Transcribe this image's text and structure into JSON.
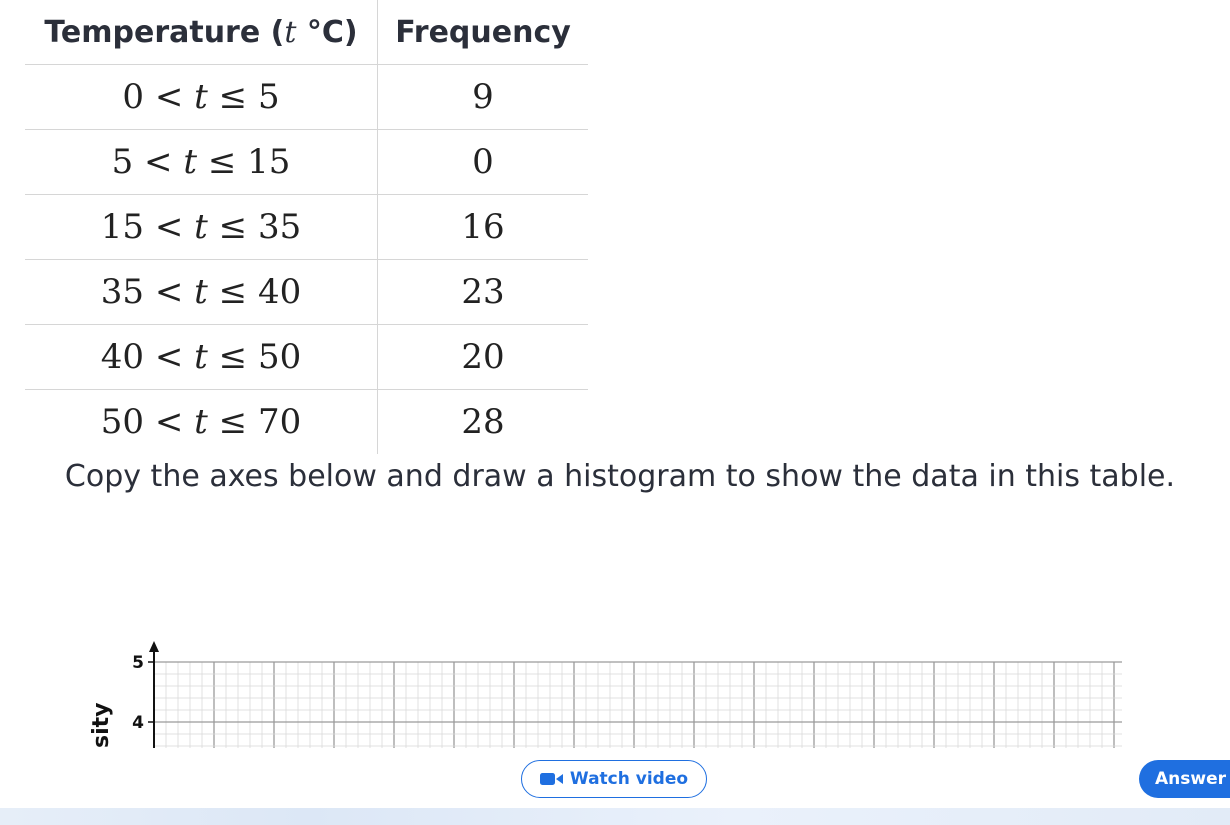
{
  "table": {
    "header": {
      "temp_prefix": "Temperature (",
      "temp_var": "t",
      "temp_unit": " °C)",
      "frequency": "Frequency"
    },
    "rows": [
      {
        "lower": "0",
        "var": "t",
        "upper": "5",
        "frequency": "9"
      },
      {
        "lower": "5",
        "var": "t",
        "upper": "15",
        "frequency": "0"
      },
      {
        "lower": "15",
        "var": "t",
        "upper": "35",
        "frequency": "16"
      },
      {
        "lower": "35",
        "var": "t",
        "upper": "40",
        "frequency": "23"
      },
      {
        "lower": "40",
        "var": "t",
        "upper": "50",
        "frequency": "20"
      },
      {
        "lower": "50",
        "var": "t",
        "upper": "70",
        "frequency": "28"
      }
    ],
    "lt": " < ",
    "le": " ≤ "
  },
  "instruction": "Copy the axes below and draw a histogram to show the data in this table.",
  "axes": {
    "y_label_partial": "sity",
    "y_ticks": [
      "5",
      "4"
    ]
  },
  "actions": {
    "watch_video": "Watch video",
    "answer": "Answer",
    "video_icon": "video-camera-icon"
  },
  "colors": {
    "accent": "#1f6fe0",
    "grid_major": "#9a9a9a",
    "grid_minor": "#d9d9d9"
  }
}
